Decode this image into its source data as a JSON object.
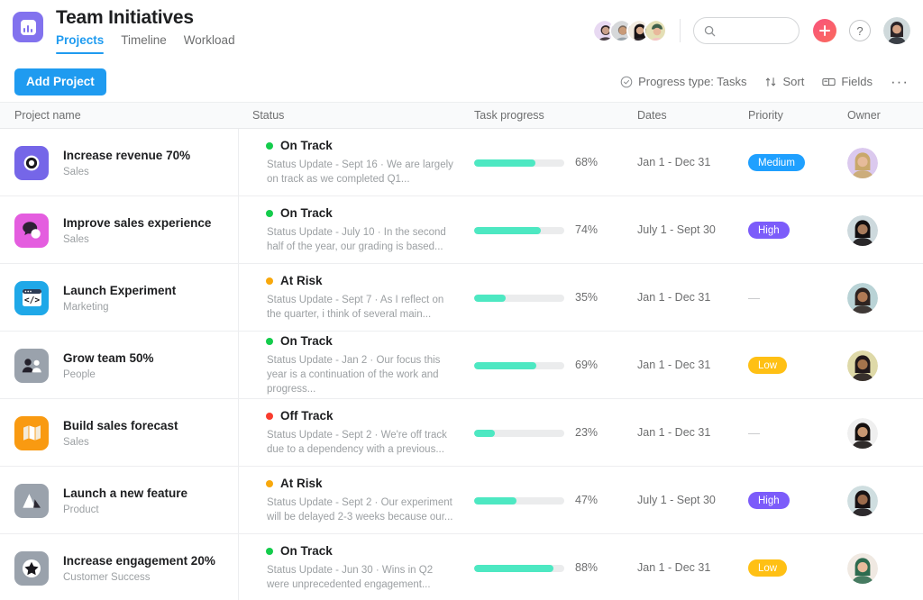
{
  "header": {
    "logo_icon": "chart-logo-icon",
    "title": "Team Initiatives",
    "tabs": [
      {
        "label": "Projects",
        "active": true
      },
      {
        "label": "Timeline",
        "active": false
      },
      {
        "label": "Workload",
        "active": false
      }
    ],
    "search": {
      "placeholder": "",
      "value": "",
      "icon": "search-icon"
    },
    "add_button_icon": "plus-icon",
    "help_button_label": "?",
    "member_avatars": [
      {
        "name": "member-avatar-1",
        "bg": "#e8d9f2",
        "skin": "#caa08b",
        "hair": "#2b2225"
      },
      {
        "name": "member-avatar-2",
        "bg": "#d6d8da",
        "skin": "#c89a78",
        "hair": "#7a6a5e"
      },
      {
        "name": "member-avatar-3",
        "bg": "#f2ebe0",
        "skin": "#d7a98a",
        "hair": "#171214"
      },
      {
        "name": "member-avatar-4",
        "bg": "#e4dfb5",
        "skin": "#e8b89b",
        "hair": "#3f5f4a"
      }
    ],
    "current_user_avatar": {
      "name": "current-user-avatar",
      "bg": "#cfd9db",
      "skin": "#d4a183",
      "hair": "#2a2327"
    }
  },
  "toolbar": {
    "add_project_label": "Add Project",
    "progress_type_label": "Progress type: Tasks",
    "progress_type_icon": "check-circle-icon",
    "sort_label": "Sort",
    "sort_icon": "sort-arrows-icon",
    "fields_label": "Fields",
    "fields_icon": "fields-icon",
    "more_label": "···"
  },
  "table": {
    "columns": [
      {
        "key": "name",
        "label": "Project name"
      },
      {
        "key": "status",
        "label": "Status"
      },
      {
        "key": "progress",
        "label": "Task progress"
      },
      {
        "key": "dates",
        "label": "Dates"
      },
      {
        "key": "priority",
        "label": "Priority"
      },
      {
        "key": "owner",
        "label": "Owner"
      }
    ],
    "status_colors": {
      "On Track": "#14cc4c",
      "At Risk": "#f8a80c",
      "Off Track": "#f93c2e"
    },
    "priority_colors": {
      "Medium": "#1fa0ff",
      "High": "#7c5cfa",
      "Low": "#ffc014"
    },
    "progress_fill_color": "#4de8c2",
    "progress_track_color": "#ebeced",
    "rows": [
      {
        "name": "Increase revenue 70%",
        "team": "Sales",
        "icon": "target-icon",
        "icon_bg": "#7566e8",
        "status": "On Track",
        "status_update": "Status Update - Sept 16 · We are largely on track as we completed Q1...",
        "progress_pct": 68,
        "progress_label": "68%",
        "dates": "Jan 1 - Dec 31",
        "priority": "Medium",
        "owner_avatar": {
          "name": "owner-avatar-1",
          "bg": "#dbc9ee",
          "skin": "#e6bb9a",
          "hair": "#c9a86b"
        }
      },
      {
        "name": "Improve sales experience",
        "team": "Sales",
        "icon": "speech-bubbles-icon",
        "icon_bg": "#e45ddf",
        "status": "On Track",
        "status_update": "Status Update - July 10 · In the second half of the year, our grading is based...",
        "progress_pct": 74,
        "progress_label": "74%",
        "dates": "July 1 - Sept 30",
        "priority": "High",
        "owner_avatar": {
          "name": "owner-avatar-2",
          "bg": "#cdd9dd",
          "skin": "#a87b5c",
          "hair": "#120e10"
        }
      },
      {
        "name": "Launch Experiment",
        "team": "Marketing",
        "icon": "code-window-icon",
        "icon_bg": "#1fa8e8",
        "status": "At Risk",
        "status_update": "Status Update - Sept 7 · As I reflect on the quarter, i think of several main...",
        "progress_pct": 35,
        "progress_label": "35%",
        "dates": "Jan 1 - Dec 31",
        "priority": "",
        "owner_avatar": {
          "name": "owner-avatar-3",
          "bg": "#b9d3d6",
          "skin": "#b07a55",
          "hair": "#2e2320"
        }
      },
      {
        "name": "Grow team 50%",
        "team": "People",
        "icon": "people-icon",
        "icon_bg": "#9aa2ac",
        "status": "On Track",
        "status_update": "Status Update - Jan 2 · Our focus this year is a continuation of the work and progress...",
        "progress_pct": 69,
        "progress_label": "69%",
        "dates": "Jan 1 - Dec 31",
        "priority": "Low",
        "owner_avatar": {
          "name": "owner-avatar-4",
          "bg": "#ded9a8",
          "skin": "#a5744c",
          "hair": "#20181a"
        }
      },
      {
        "name": "Build sales forecast",
        "team": "Sales",
        "icon": "map-icon",
        "icon_bg": "#f99a11",
        "status": "Off Track",
        "status_update": "Status Update - Sept 2 · We're off track due to a dependency with a previous...",
        "progress_pct": 23,
        "progress_label": "23%",
        "dates": "Jan 1 - Dec 31",
        "priority": "",
        "owner_avatar": {
          "name": "owner-avatar-5",
          "bg": "#efefef",
          "skin": "#c99872",
          "hair": "#15100f"
        }
      },
      {
        "name": "Launch a new feature",
        "team": "Product",
        "icon": "mountain-icon",
        "icon_bg": "#9aa2ac",
        "status": "At Risk",
        "status_update": "Status Update - Sept 2 · Our experiment will be delayed 2-3 weeks because our...",
        "progress_pct": 47,
        "progress_label": "47%",
        "dates": "July 1 - Sept 30",
        "priority": "High",
        "owner_avatar": {
          "name": "owner-avatar-6",
          "bg": "#cfdee0",
          "skin": "#9c6b4c",
          "hair": "#171113"
        }
      },
      {
        "name": "Increase engagement 20%",
        "team": "Customer Success",
        "icon": "star-icon",
        "icon_bg": "#9aa2ac",
        "status": "On Track",
        "status_update": "Status Update - Jun 30 · Wins in Q2 were unprecedented engagement...",
        "progress_pct": 88,
        "progress_label": "88%",
        "dates": "Jan 1 - Dec 31",
        "priority": "Low",
        "owner_avatar": {
          "name": "owner-avatar-7",
          "bg": "#f0e9e2",
          "skin": "#e9bb9c",
          "hair": "#2d6b4f"
        }
      }
    ]
  }
}
